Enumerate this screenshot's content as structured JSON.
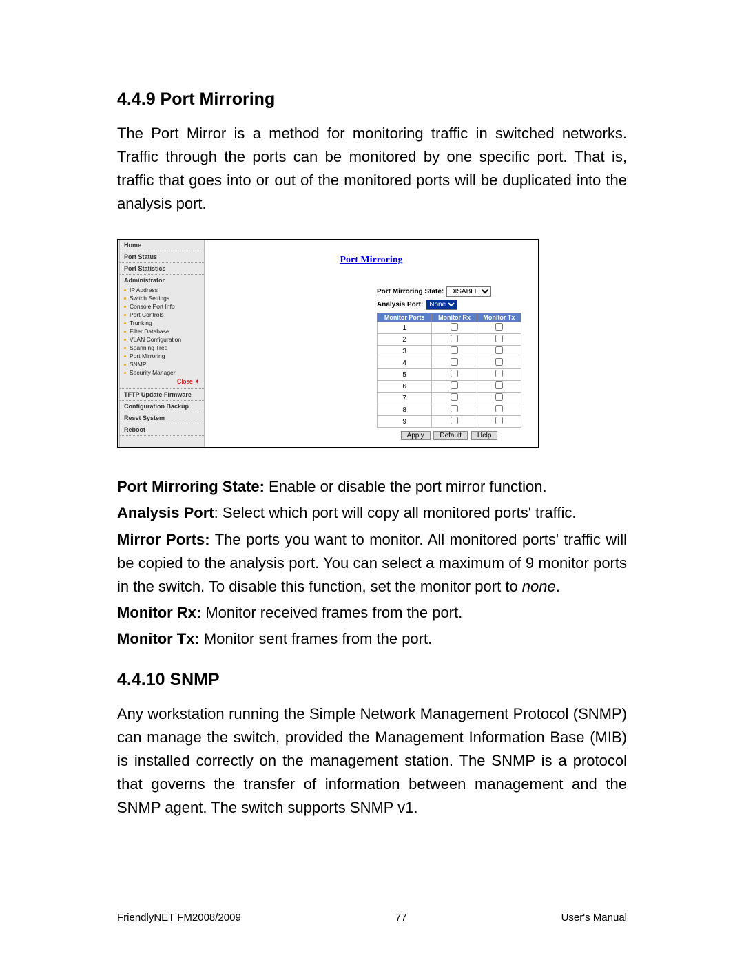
{
  "sections": {
    "s1_heading": "4.4.9 Port Mirroring",
    "s1_para": "The Port Mirror is a method for monitoring traffic in switched networks. Traffic through the ports can be monitored by one specific port. That is, traffic that goes into or out of the monitored ports will be duplicated into the analysis port.",
    "s2_heading": "4.4.10 SNMP",
    "s2_para": "Any workstation running the Simple Network Management Protocol (SNMP) can manage the switch, provided the Management Information Base (MIB) is installed correctly on the management station. The SNMP is a protocol that governs the transfer of information between management and the SNMP agent. The switch supports SNMP v1."
  },
  "defs": {
    "d1_label": "Port Mirroring State:",
    "d1_text": " Enable or disable the port mirror function.",
    "d2_label": "Analysis Port",
    "d2_text": ": Select which port will copy all monitored ports' traffic.",
    "d3_label": "Mirror Ports:",
    "d3_text_a": " The ports you want to monitor. All monitored ports' traffic will be copied to the analysis port. You can select a maximum of 9 monitor ports in the switch. To disable this function, set the monitor port to ",
    "d3_text_b_italic": "none",
    "d3_text_c": ".",
    "d4_label": "Monitor Rx:",
    "d4_text": " Monitor received frames from the port.",
    "d5_label": "Monitor Tx:",
    "d5_text": " Monitor sent frames from the port."
  },
  "nav": {
    "sec1": "Home",
    "sec2": "Port Status",
    "sec3": "Port Statistics",
    "sec4": "Administrator",
    "subs": [
      "IP Address",
      "Switch Settings",
      "Console Port Info",
      "Port Controls",
      "Trunking",
      "Filter Database",
      "VLAN Configuration",
      "Spanning Tree",
      "Port Mirroring",
      "SNMP",
      "Security Manager"
    ],
    "close": "Close",
    "sec5": "TFTP Update Firmware",
    "sec6": "Configuration Backup",
    "sec7": "Reset System",
    "sec8": "Reboot"
  },
  "shot": {
    "title": "Port Mirroring",
    "state_label": "Port Mirroring State:",
    "state_value": "DISABLE",
    "analysis_label": "Analysis Port:",
    "analysis_value": "None",
    "th1": "Monitor Ports",
    "th2": "Monitor Rx",
    "th3": "Monitor Tx",
    "ports": [
      "1",
      "2",
      "3",
      "4",
      "5",
      "6",
      "7",
      "8",
      "9"
    ],
    "btn_apply": "Apply",
    "btn_default": "Default",
    "btn_help": "Help"
  },
  "footer": {
    "left": "FriendlyNET FM2008/2009",
    "center": "77",
    "right": "User's Manual"
  }
}
